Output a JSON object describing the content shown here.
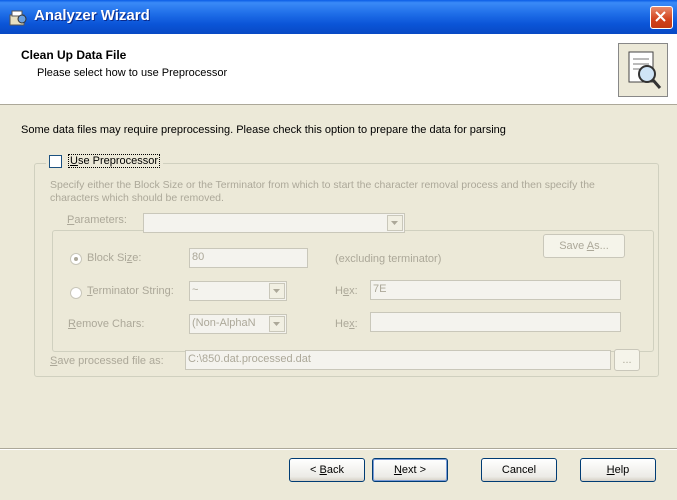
{
  "window": {
    "title": "Analyzer Wizard"
  },
  "header": {
    "title": "Clean Up Data File",
    "subtitle": "Please select how to use Preprocessor"
  },
  "intro_text": "Some data files may require preprocessing. Please check this option to prepare the data for parsing",
  "preprocessor": {
    "checkbox_prefix": "U",
    "checkbox_rest": "se Preprocessor",
    "checked": false,
    "description": "Specify either the Block Size or the Terminator from which to start the character removal process and then specify the characters which should be removed."
  },
  "parameters": {
    "label_prefix": "P",
    "label_rest": "arameters:",
    "value": "",
    "save_as_prefix": "Save ",
    "save_as_u": "A",
    "save_as_rest": "s...",
    "block_size": {
      "label_start": "Block Si",
      "label_u": "z",
      "label_end": "e:",
      "value": "80",
      "note": "(excluding terminator)",
      "selected": true
    },
    "terminator": {
      "label_u": "T",
      "label_rest": "erminator String:",
      "value": "~",
      "hex_label_start": "H",
      "hex_label_u": "e",
      "hex_label_end": "x:",
      "hex_value": "7E",
      "selected": false
    },
    "remove_chars": {
      "label_u": "R",
      "label_rest": "emove Chars:",
      "value": "(Non-AlphaN",
      "hex_label_start": "He",
      "hex_label_u": "x",
      "hex_label_end": ":",
      "hex_value": ""
    }
  },
  "save_processed": {
    "label_u": "S",
    "label_rest": "ave processed file as:",
    "value": "C:\\850.dat.processed.dat",
    "browse_label": "..."
  },
  "buttons": {
    "back_prefix": "< ",
    "back_u": "B",
    "back_rest": "ack",
    "next_u": "N",
    "next_rest": "ext >",
    "cancel": "Cancel",
    "help_u": "H",
    "help_rest": "elp"
  }
}
